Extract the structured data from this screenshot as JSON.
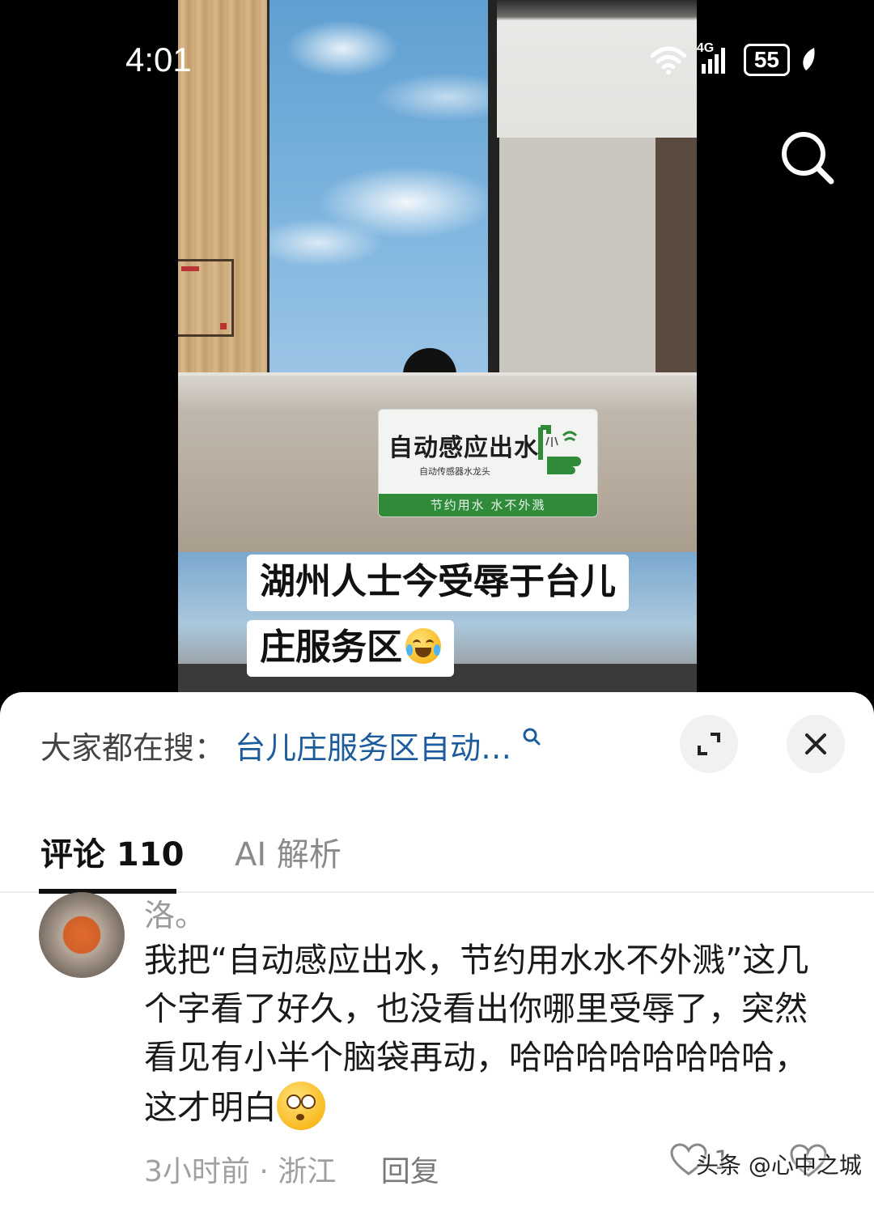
{
  "status_bar": {
    "time": "4:01",
    "network": "4G",
    "battery": "55"
  },
  "video": {
    "sign": {
      "title": "自动感应出水",
      "subtitle": "自动传感器水龙头",
      "footer": "节约用水   水不外溅"
    },
    "caption_line1": "湖州人士今受辱于台儿",
    "caption_line2": "庄服务区"
  },
  "sheet": {
    "trending_label": "大家都在搜：",
    "trending_query": "台儿庄服务区自动…",
    "tabs": [
      {
        "label": "评论 110",
        "active": true
      },
      {
        "label": "AI 解析",
        "active": false
      }
    ],
    "comment": {
      "username": "洛。",
      "text": "我把“自动感应出水，节约用水水不外溅”这几个字看了好久，也没看出你哪里受辱了，突然看见有小半个脑袋再动，哈哈哈哈哈哈哈哈，这才明白",
      "time": "3小时前",
      "location": "浙江",
      "reply_label": "回复",
      "like_count": "1"
    }
  },
  "watermark": "头条 @心中之城",
  "colors": {
    "link": "#1c5c9c",
    "sign_green": "#2f8a3a"
  }
}
